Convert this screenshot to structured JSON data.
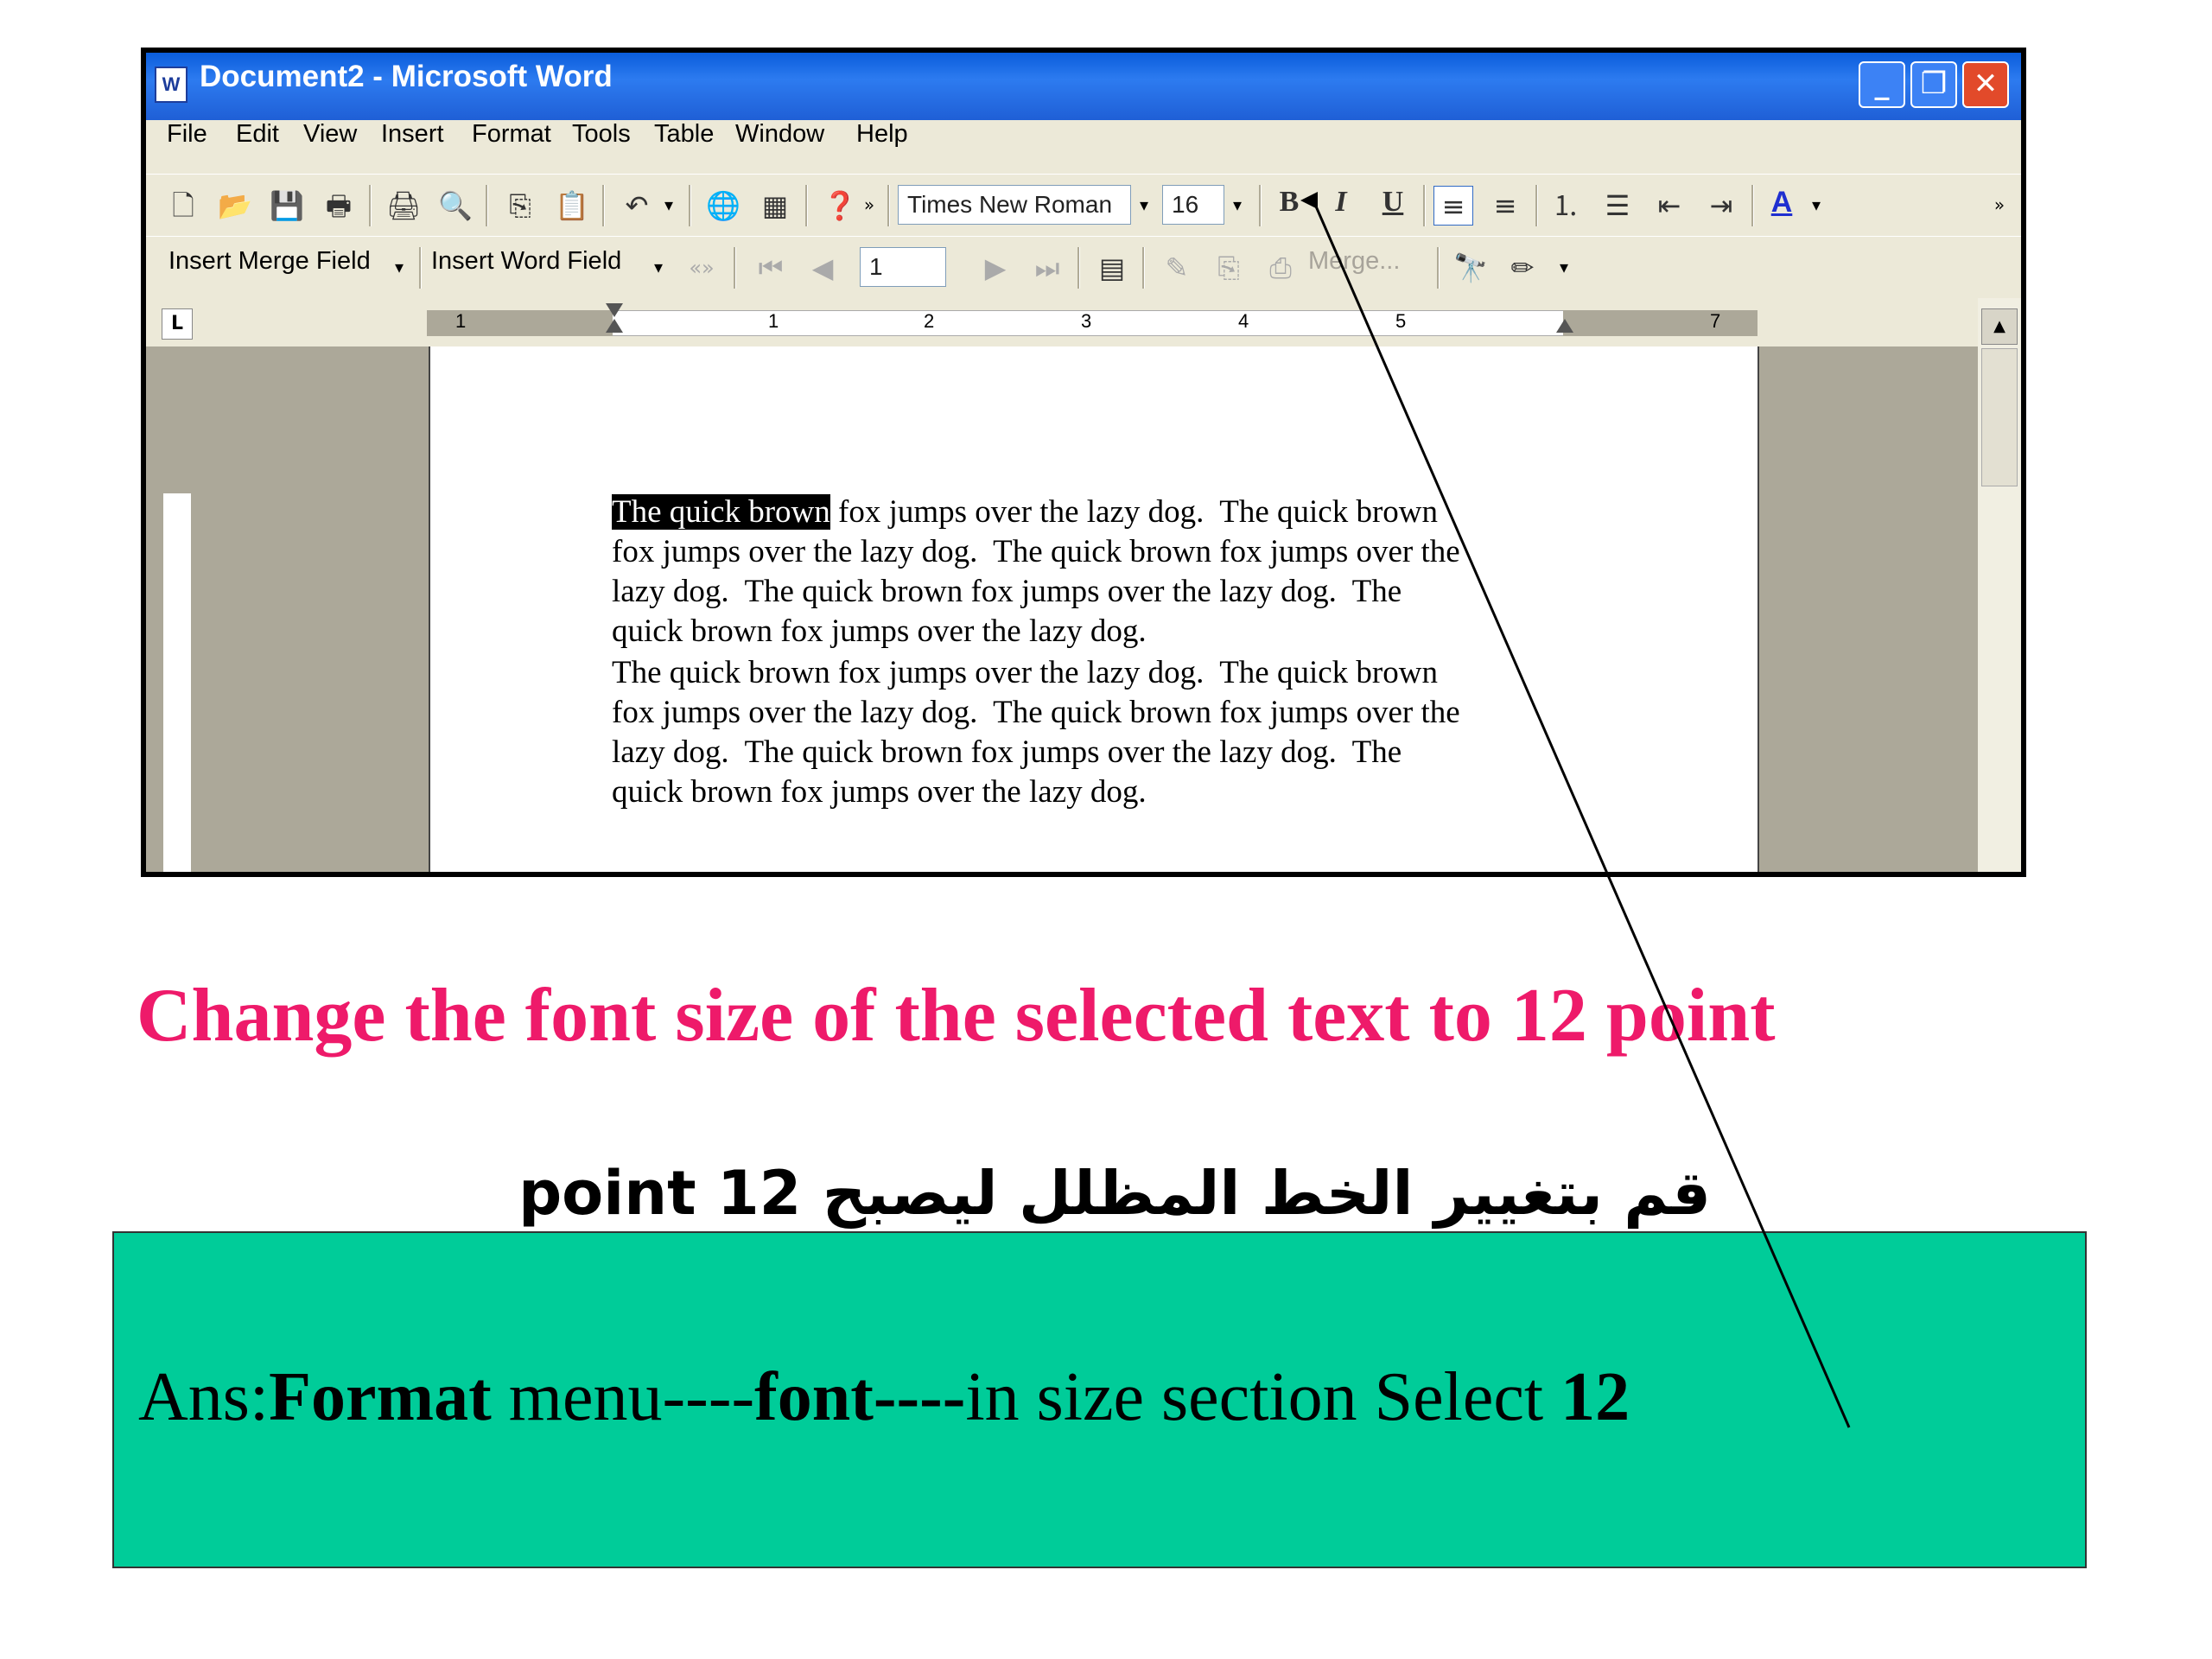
{
  "window": {
    "title": "Document2 - Microsoft Word",
    "title_icon": "W",
    "controls": [
      "minimize-icon",
      "restore-icon",
      "close-icon"
    ]
  },
  "menubar": {
    "items": [
      "File",
      "Edit",
      "View",
      "Insert",
      "Format",
      "Tools",
      "Table",
      "Window",
      "Help"
    ]
  },
  "toolbar": {
    "font_name": "Times New Roman",
    "font_size": "16",
    "bold": "B",
    "italic": "I",
    "underline": "U",
    "font_color_glyph": "A"
  },
  "mailmerge": {
    "insert_merge_field": "Insert Merge Field",
    "insert_word_field": "Insert Word Field",
    "record_number": "1",
    "merge_label": "Merge..."
  },
  "ruler": {
    "numbers": [
      "1",
      "1",
      "2",
      "3",
      "4",
      "5",
      "7"
    ]
  },
  "document": {
    "selected_text": "The quick brown",
    "lines": [
      " fox jumps over the lazy dog.  The quick brown",
      "fox jumps over the lazy dog.  The quick brown fox jumps over the",
      "lazy dog.  The quick brown fox jumps over the lazy dog.  The",
      "quick brown fox jumps over the lazy dog.",
      "The quick brown fox jumps over the lazy dog.  The quick brown",
      "fox jumps over the lazy dog.  The quick brown fox jumps over the",
      "lazy dog.  The quick brown fox jumps over the lazy dog.  The",
      "quick brown fox jumps over the lazy dog."
    ]
  },
  "instruction": {
    "english": "Change the font size of the selected text to 12 point",
    "arabic": "قم بتغيير الخط المظلل ليصبح 12 point"
  },
  "answer": {
    "prefix": "Ans:",
    "format": "Format",
    "menu": " menu----",
    "font": "font----",
    "middle": "in size section Select ",
    "size": "12"
  },
  "colors": {
    "headline": "#ee1a6a",
    "answer_box": "#00cc99",
    "titlebar": "#0a5ddb"
  }
}
